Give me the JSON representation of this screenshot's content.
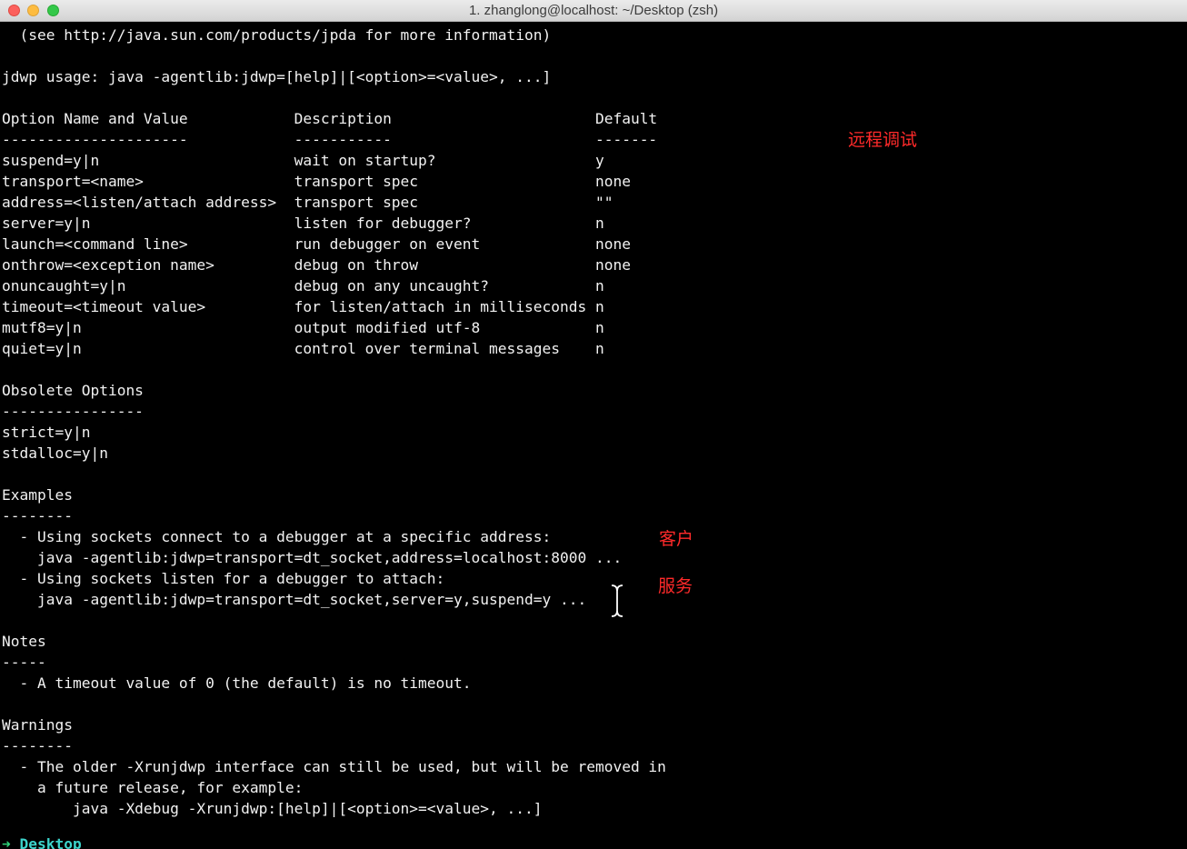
{
  "window": {
    "title": "1. zhanglong@localhost: ~/Desktop (zsh)"
  },
  "terminal": {
    "lines": [
      "  (see http://java.sun.com/products/jpda for more information)",
      "",
      "jdwp usage: java -agentlib:jdwp=[help]|[<option>=<value>, ...]",
      "",
      "Option Name and Value            Description                       Default",
      "---------------------            -----------                       -------",
      "suspend=y|n                      wait on startup?                  y",
      "transport=<name>                 transport spec                    none",
      "address=<listen/attach address>  transport spec                    \"\"",
      "server=y|n                       listen for debugger?              n",
      "launch=<command line>            run debugger on event             none",
      "onthrow=<exception name>         debug on throw                    none",
      "onuncaught=y|n                   debug on any uncaught?            n",
      "timeout=<timeout value>          for listen/attach in milliseconds n",
      "mutf8=y|n                        output modified utf-8             n",
      "quiet=y|n                        control over terminal messages    n",
      "",
      "Obsolete Options",
      "----------------",
      "strict=y|n",
      "stdalloc=y|n",
      "",
      "Examples",
      "--------",
      "  - Using sockets connect to a debugger at a specific address:",
      "    java -agentlib:jdwp=transport=dt_socket,address=localhost:8000 ...",
      "  - Using sockets listen for a debugger to attach:",
      "    java -agentlib:jdwp=transport=dt_socket,server=y,suspend=y ...",
      "",
      "Notes",
      "-----",
      "  - A timeout value of 0 (the default) is no timeout.",
      "",
      "Warnings",
      "--------",
      "  - The older -Xrunjdwp interface can still be used, but will be removed in",
      "    a future release, for example:",
      "        java -Xdebug -Xrunjdwp:[help]|[<option>=<value>, ...]",
      ""
    ],
    "prompt": {
      "arrow": "➜",
      "dir": "Desktop"
    }
  },
  "annotations": {
    "remote_debug": "远程调试",
    "client": "客户",
    "server": "服务"
  },
  "colors": {
    "background": "#000000",
    "text": "#f2f2f2",
    "annotation": "#ff2a2a",
    "prompt_dir": "#3cd3cb",
    "prompt_arrow": "#2fd47a"
  },
  "icons": {
    "cursor": "text-cursor-icon"
  }
}
